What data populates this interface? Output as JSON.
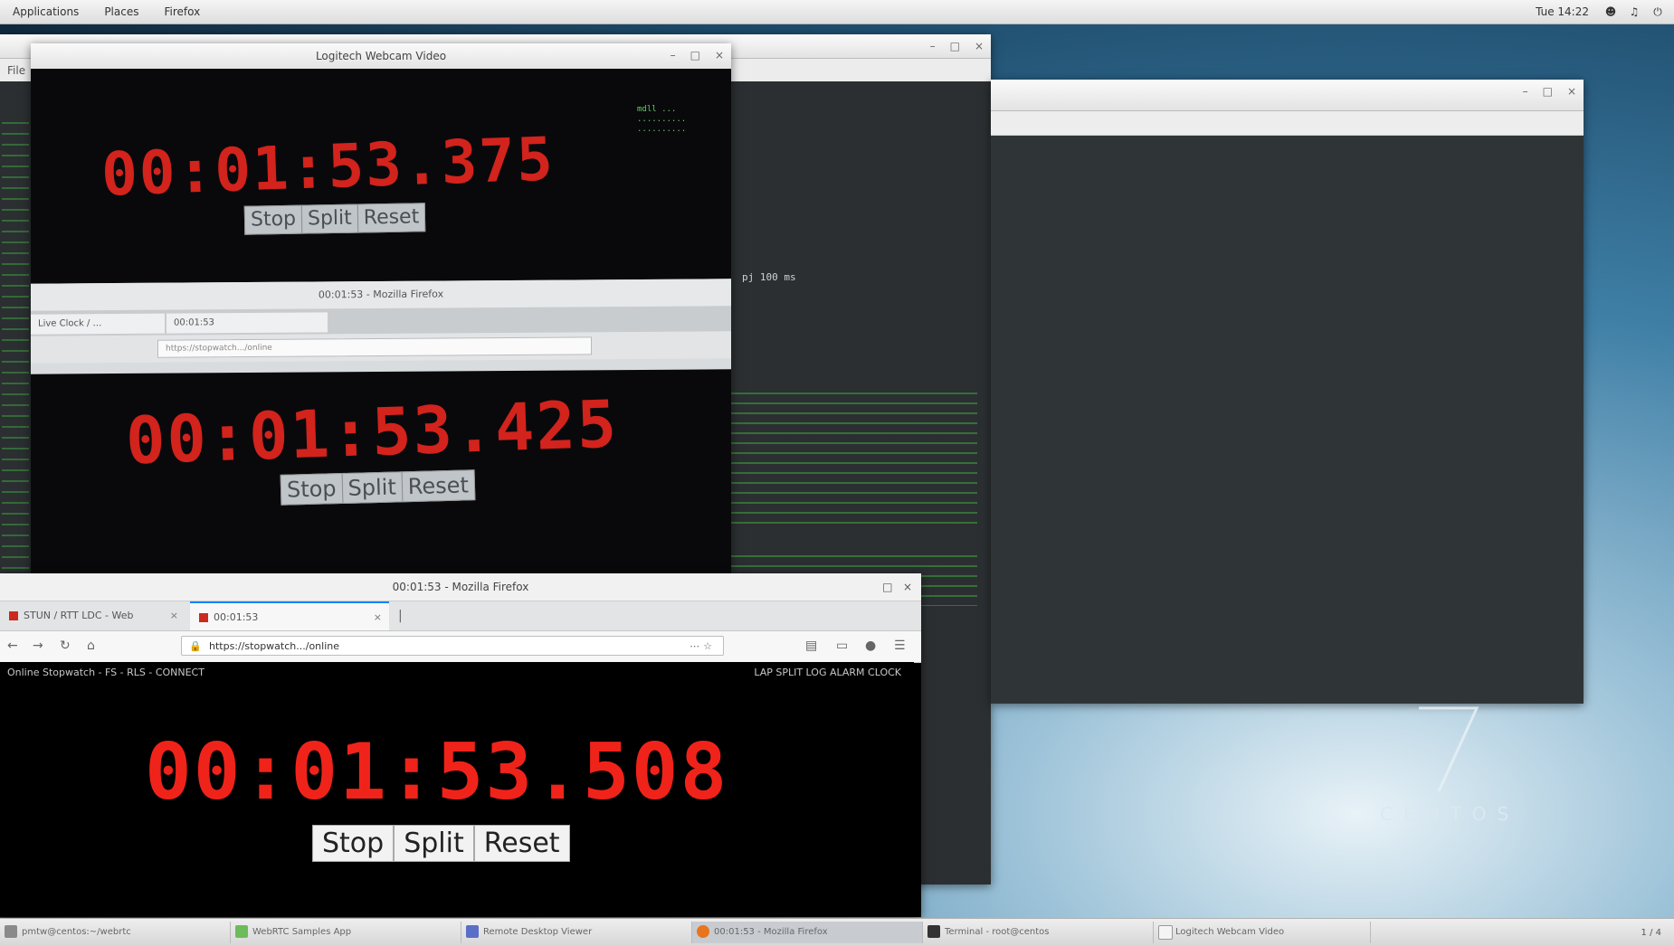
{
  "top_panel": {
    "menu": [
      "Applications",
      "Places",
      "Firefox"
    ],
    "clock": "Tue 14:22",
    "tray": [
      "user-icon",
      "volume-icon",
      "power-icon"
    ]
  },
  "terminal": {
    "menu": "File",
    "right_text": "pj 100 ms"
  },
  "camera_window": {
    "title": "Logitech Webcam Video",
    "top_clock": "00:01:53.375",
    "mid_clock": "00:01:53.425",
    "top_buttons": [
      "Stop",
      "Split",
      "Reset"
    ],
    "mid_buttons": [
      "Stop",
      "Split",
      "Reset"
    ],
    "photo_browser_title": "00:01:53 - Mozilla Firefox",
    "photo_tab_1": "Live Clock / …",
    "photo_tab_2": "00:01:53",
    "photo_url": "https://stopwatch.../online"
  },
  "firefox": {
    "title": "00:01:53 - Mozilla Firefox",
    "tab_1": "STUN / RTT LDC - Web",
    "tab_2": "00:01:53",
    "url": "https://stopwatch.../online",
    "topnav_left": "Online Stopwatch - FS - RLS - CONNECT",
    "topnav_right": "LAP  SPLIT  LOG  ALARM  CLOCK",
    "clock": "00:01:53.508",
    "buttons": {
      "stop": "Stop",
      "split": "Split",
      "reset": "Reset"
    }
  },
  "centos": {
    "seven": "7",
    "text": "CENTOS"
  },
  "taskbar": {
    "items": [
      "pmtw@centos:~/webrtc",
      "WebRTC Samples App",
      "Remote Desktop Viewer",
      "00:01:53 - Mozilla Firefox",
      "Terminal - root@centos",
      "Logitech Webcam Video"
    ],
    "time": "1 / 4"
  },
  "colors": {
    "clock_red": "#d2231c",
    "terminal_green": "#7be07b",
    "accent_tab": "#0a84ff"
  }
}
